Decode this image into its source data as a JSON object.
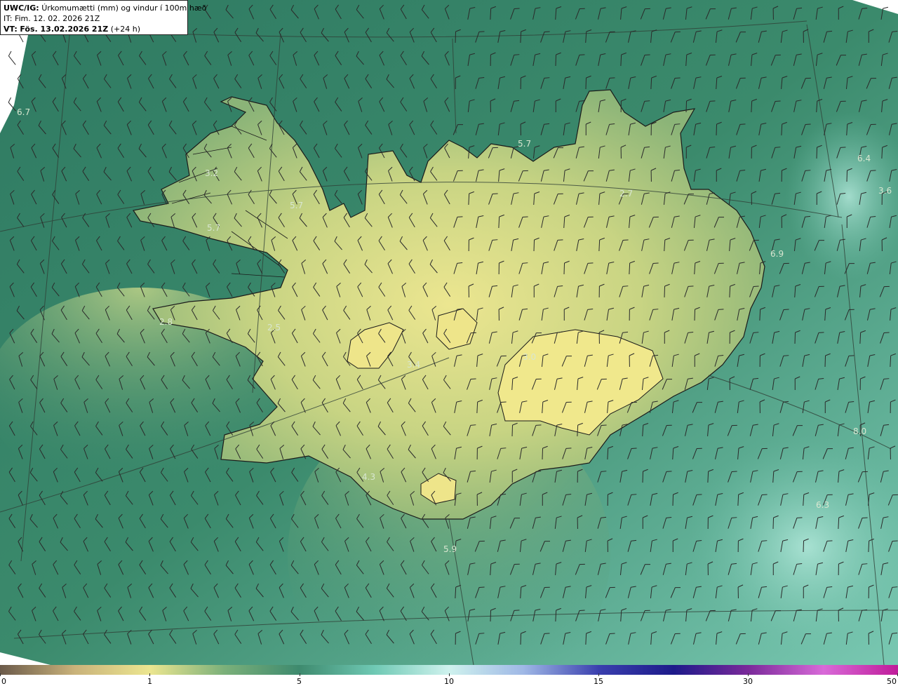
{
  "header": {
    "product": "UWC/IG:",
    "title": "Úrkomumætti (mm) og vindur í 100m hæð",
    "init_time": "IT: Fim. 12. 02. 2026 21Z",
    "valid_prefix": "VT:",
    "valid_time": "Fös. 13.02.2026 21Z",
    "lead_time": "(+24 h)"
  },
  "colors": {
    "sea_base": "#3e8a6e",
    "land_high": "#ece690",
    "land_mid": "#a8c27a",
    "coast": "#1a1a1a",
    "grid": "#2f3f36",
    "barb": "#2a2a2a"
  },
  "value_labels": [
    {
      "text": "6.7"
    },
    {
      "text": "3.2"
    },
    {
      "text": "5.7"
    },
    {
      "text": "5.7"
    },
    {
      "text": "5.7"
    },
    {
      "text": "2.7"
    },
    {
      "text": "6.4"
    },
    {
      "text": "3.6"
    },
    {
      "text": "6.9"
    },
    {
      "text": "2.8"
    },
    {
      "text": "2.5"
    },
    {
      "text": "3.4"
    },
    {
      "text": "3.0"
    },
    {
      "text": "8.0"
    },
    {
      "text": "4.3"
    },
    {
      "text": "6.3"
    },
    {
      "text": "5.9"
    }
  ],
  "colorbar": {
    "unit_note": "mm",
    "ticks": [
      "0",
      "1",
      "5",
      "10",
      "15",
      "30",
      "50"
    ],
    "stops": [
      "#6b5a4a",
      "#c9b27a",
      "#ece690",
      "#7bb07a",
      "#3e8a6e",
      "#6fc9b4",
      "#cff2ee",
      "#9fb8e6",
      "#3a3fae",
      "#1d1a8a",
      "#7a2a9a",
      "#d86ad8",
      "#c01c9a"
    ]
  }
}
